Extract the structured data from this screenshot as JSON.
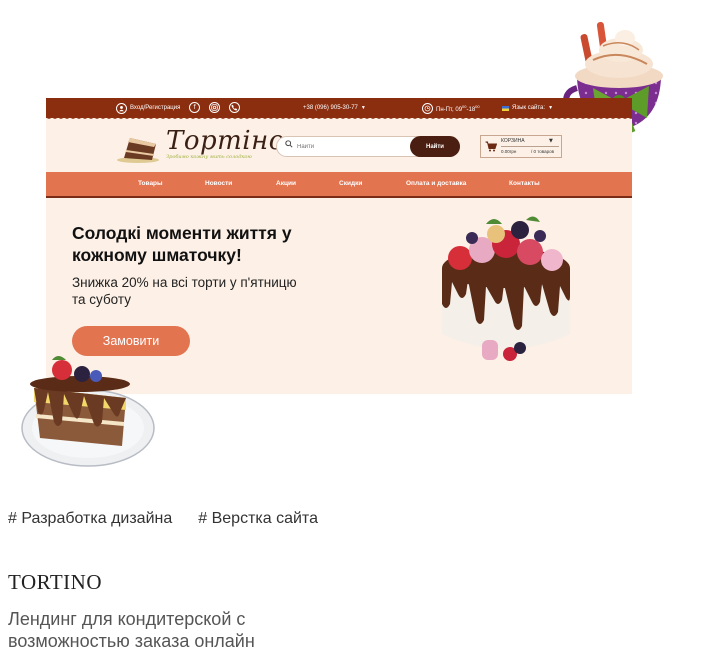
{
  "site": {
    "topbar": {
      "login": "Вход/Регистрация",
      "phone": "+38 (096) 905-30-77",
      "hours_prefix": "Пн-Пт, 09",
      "hours_sup1": "00",
      "hours_mid": "-18",
      "hours_sup2": "00",
      "language": "Язык сайта:"
    },
    "logo": {
      "name": "Тортіно",
      "tagline": "Зробимо кожну мить солодкою"
    },
    "search": {
      "placeholder": "Найти",
      "button": "Найти"
    },
    "cart": {
      "title": "КОРЗИНА",
      "sum": "0.00грн",
      "count": "/ 0 товаров"
    },
    "nav": [
      "Товары",
      "Новости",
      "Акции",
      "Скидки",
      "Оплата и доставка",
      "Контакты"
    ],
    "hero": {
      "title": "Солодкі моменти життя у кожному шматочку!",
      "subtitle": "Знижка 20% на всі торти у п'ятницю та суботу",
      "button": "Замовити"
    },
    "colors": {
      "topbar": "#8b2d0f",
      "nav": "#e37450",
      "background": "#fdf0e6",
      "button": "#e37450"
    }
  },
  "tags": [
    "# Разработка дизайна",
    "# Верстка сайта"
  ],
  "project": {
    "title": "TORTINO",
    "description": "Лендинг для кондитерской с возможностью заказа онлайн"
  },
  "icons": [
    "user-icon",
    "facebook-icon",
    "instagram-icon",
    "phone-icon",
    "clock-icon",
    "flag-icon",
    "search-icon",
    "cart-icon"
  ]
}
